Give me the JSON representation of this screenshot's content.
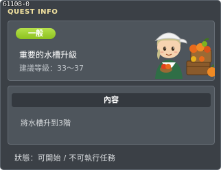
{
  "quest_id": "61108-0",
  "window_title": "QUEST INFO",
  "quest": {
    "category": "一般",
    "name": "重要的水槽升級",
    "level_requirement": "建議等級：33～37"
  },
  "content": {
    "header": "內容",
    "description": "將水槽升到3階"
  },
  "status": "狀態：可開始 / 不可執行任務",
  "colors": {
    "window_bg": "#3b4046",
    "panel_bg": "#4e555c",
    "badge_green": "#8dc21f",
    "title_yellow": "#f3e3a0"
  },
  "npc": {
    "icon": "farmer-npc-with-fruit-crates"
  }
}
